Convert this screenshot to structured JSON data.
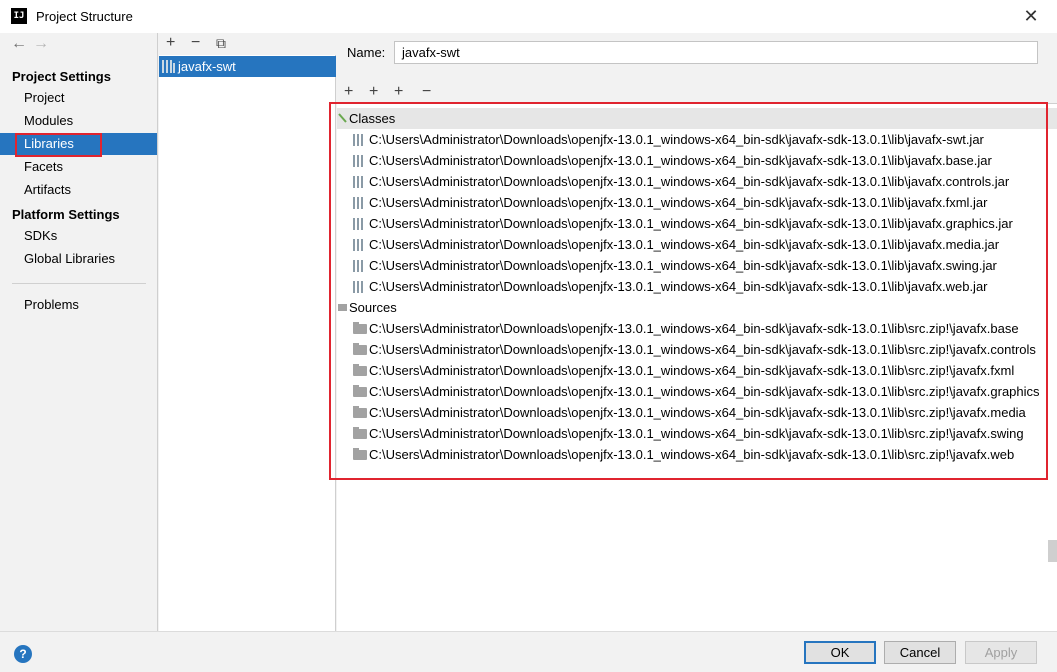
{
  "window": {
    "title": "Project Structure",
    "app_icon_text": "IJ",
    "close_glyph": "✕"
  },
  "nav": {
    "back_glyph": "←",
    "forward_glyph": "→"
  },
  "sidebar": {
    "project_settings_header": "Project Settings",
    "platform_settings_header": "Platform Settings",
    "items": [
      {
        "label": "Project"
      },
      {
        "label": "Modules"
      },
      {
        "label": "Libraries",
        "selected": true
      },
      {
        "label": "Facets"
      },
      {
        "label": "Artifacts"
      },
      {
        "label": "SDKs"
      },
      {
        "label": "Global Libraries"
      },
      {
        "label": "Problems"
      }
    ]
  },
  "library_list": {
    "toolbar": {
      "add": "+",
      "remove": "−",
      "copy": "⧉"
    },
    "items": [
      {
        "label": "javafx-swt"
      }
    ]
  },
  "detail": {
    "name_label": "Name:",
    "name_value": "javafx-swt",
    "toolbar": {
      "add": "+",
      "add_classes": "+",
      "add_special": "+",
      "remove": "−"
    },
    "classes_label": "Classes",
    "sources_label": "Sources",
    "classes": [
      "C:\\Users\\Administrator\\Downloads\\openjfx-13.0.1_windows-x64_bin-sdk\\javafx-sdk-13.0.1\\lib\\javafx-swt.jar",
      "C:\\Users\\Administrator\\Downloads\\openjfx-13.0.1_windows-x64_bin-sdk\\javafx-sdk-13.0.1\\lib\\javafx.base.jar",
      "C:\\Users\\Administrator\\Downloads\\openjfx-13.0.1_windows-x64_bin-sdk\\javafx-sdk-13.0.1\\lib\\javafx.controls.jar",
      "C:\\Users\\Administrator\\Downloads\\openjfx-13.0.1_windows-x64_bin-sdk\\javafx-sdk-13.0.1\\lib\\javafx.fxml.jar",
      "C:\\Users\\Administrator\\Downloads\\openjfx-13.0.1_windows-x64_bin-sdk\\javafx-sdk-13.0.1\\lib\\javafx.graphics.jar",
      "C:\\Users\\Administrator\\Downloads\\openjfx-13.0.1_windows-x64_bin-sdk\\javafx-sdk-13.0.1\\lib\\javafx.media.jar",
      "C:\\Users\\Administrator\\Downloads\\openjfx-13.0.1_windows-x64_bin-sdk\\javafx-sdk-13.0.1\\lib\\javafx.swing.jar",
      "C:\\Users\\Administrator\\Downloads\\openjfx-13.0.1_windows-x64_bin-sdk\\javafx-sdk-13.0.1\\lib\\javafx.web.jar"
    ],
    "sources": [
      "C:\\Users\\Administrator\\Downloads\\openjfx-13.0.1_windows-x64_bin-sdk\\javafx-sdk-13.0.1\\lib\\src.zip!\\javafx.base",
      "C:\\Users\\Administrator\\Downloads\\openjfx-13.0.1_windows-x64_bin-sdk\\javafx-sdk-13.0.1\\lib\\src.zip!\\javafx.controls",
      "C:\\Users\\Administrator\\Downloads\\openjfx-13.0.1_windows-x64_bin-sdk\\javafx-sdk-13.0.1\\lib\\src.zip!\\javafx.fxml",
      "C:\\Users\\Administrator\\Downloads\\openjfx-13.0.1_windows-x64_bin-sdk\\javafx-sdk-13.0.1\\lib\\src.zip!\\javafx.graphics",
      "C:\\Users\\Administrator\\Downloads\\openjfx-13.0.1_windows-x64_bin-sdk\\javafx-sdk-13.0.1\\lib\\src.zip!\\javafx.media",
      "C:\\Users\\Administrator\\Downloads\\openjfx-13.0.1_windows-x64_bin-sdk\\javafx-sdk-13.0.1\\lib\\src.zip!\\javafx.swing",
      "C:\\Users\\Administrator\\Downloads\\openjfx-13.0.1_windows-x64_bin-sdk\\javafx-sdk-13.0.1\\lib\\src.zip!\\javafx.web"
    ]
  },
  "footer": {
    "help_glyph": "?",
    "ok_label": "OK",
    "cancel_label": "Cancel",
    "apply_label": "Apply"
  },
  "colors": {
    "selection": "#2675bf",
    "highlight_box": "#e0242f"
  }
}
